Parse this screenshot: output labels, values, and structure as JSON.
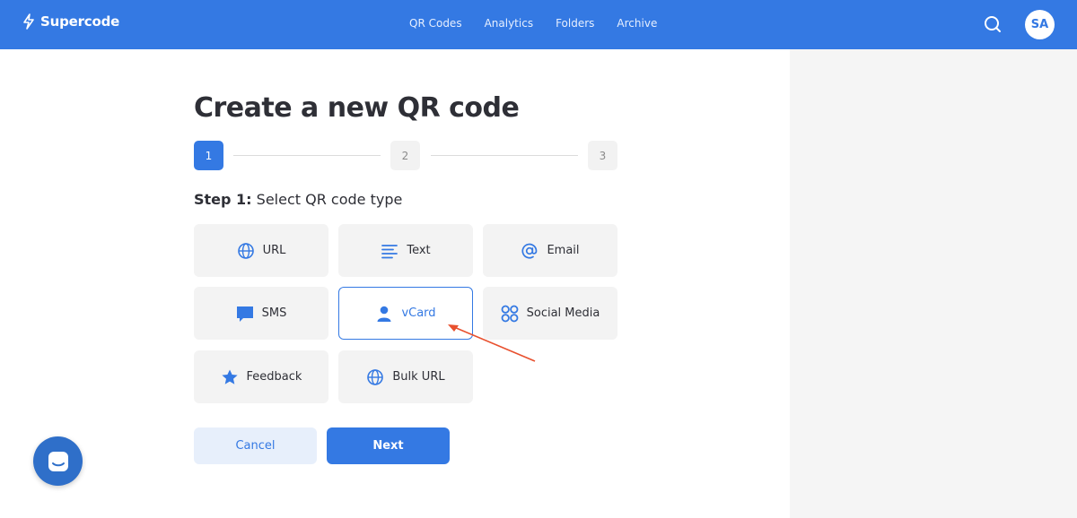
{
  "header": {
    "brand": "Supercode",
    "nav": [
      "QR Codes",
      "Analytics",
      "Folders",
      "Archive"
    ],
    "avatar_initials": "SA"
  },
  "page": {
    "title": "Create a new QR code",
    "steps": [
      "1",
      "2",
      "3"
    ],
    "active_step": 1,
    "step_label_prefix": "Step 1:",
    "step_label_text": " Select QR code type"
  },
  "types": [
    {
      "label": "URL",
      "icon": "globe-icon"
    },
    {
      "label": "Text",
      "icon": "text-lines-icon"
    },
    {
      "label": "Email",
      "icon": "at-sign-icon"
    },
    {
      "label": "SMS",
      "icon": "message-icon"
    },
    {
      "label": "vCard",
      "icon": "user-icon",
      "selected": true
    },
    {
      "label": "Social Media",
      "icon": "four-circles-icon"
    },
    {
      "label": "Feedback",
      "icon": "star-icon"
    },
    {
      "label": "Bulk URL",
      "icon": "globe-icon"
    }
  ],
  "actions": {
    "cancel": "Cancel",
    "next": "Next"
  },
  "colors": {
    "primary": "#3479e3",
    "tile_bg": "#f3f3f3",
    "annotation_arrow": "#e8502e"
  }
}
